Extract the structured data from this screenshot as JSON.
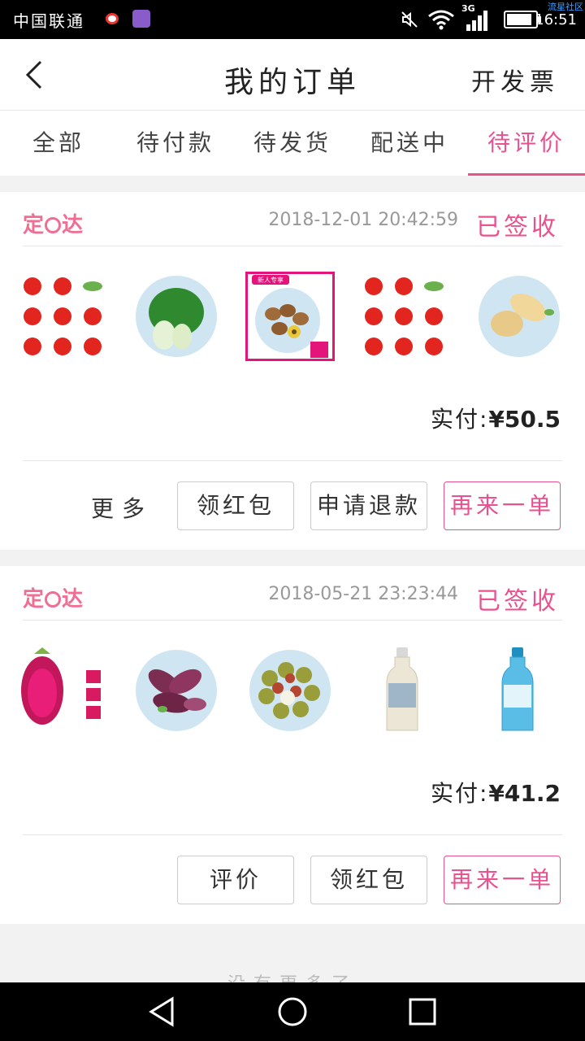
{
  "status_bar": {
    "carrier": "中国联通",
    "network": "3G",
    "time": "16:51",
    "watermark": "流星社区"
  },
  "header": {
    "title": "我的订单",
    "invoice_label": "开发票"
  },
  "tabs": [
    {
      "label": "全部",
      "active": false
    },
    {
      "label": "待付款",
      "active": false
    },
    {
      "label": "待发货",
      "active": false
    },
    {
      "label": "配送中",
      "active": false
    },
    {
      "label": "待评价",
      "active": true
    }
  ],
  "orders": [
    {
      "brand": "定时达",
      "datetime": "2018-12-01 20:42:59",
      "status": "已签收",
      "products": [
        "cherry-tomatoes",
        "bok-choy",
        "kiwi",
        "cherry-tomatoes",
        "potatoes"
      ],
      "product_badge": "新人专享",
      "total_label": "实付:",
      "total_amount": "¥50.5",
      "more_label": "更多",
      "buttons": [
        "领红包",
        "申请退款",
        "再来一单"
      ]
    },
    {
      "brand": "定时达",
      "datetime": "2018-05-21 23:23:44",
      "status": "已签收",
      "products": [
        "dragon-fruit",
        "purple-sweet-potato",
        "lychee",
        "bottled-drink",
        "bottled-drink-blue"
      ],
      "total_label": "实付:",
      "total_amount": "¥41.2",
      "buttons": [
        "评价",
        "领红包",
        "再来一单"
      ]
    }
  ],
  "footer": {
    "no_more": "没有更多了"
  },
  "colors": {
    "accent": "#e9528e",
    "brand": "#f06d93"
  }
}
